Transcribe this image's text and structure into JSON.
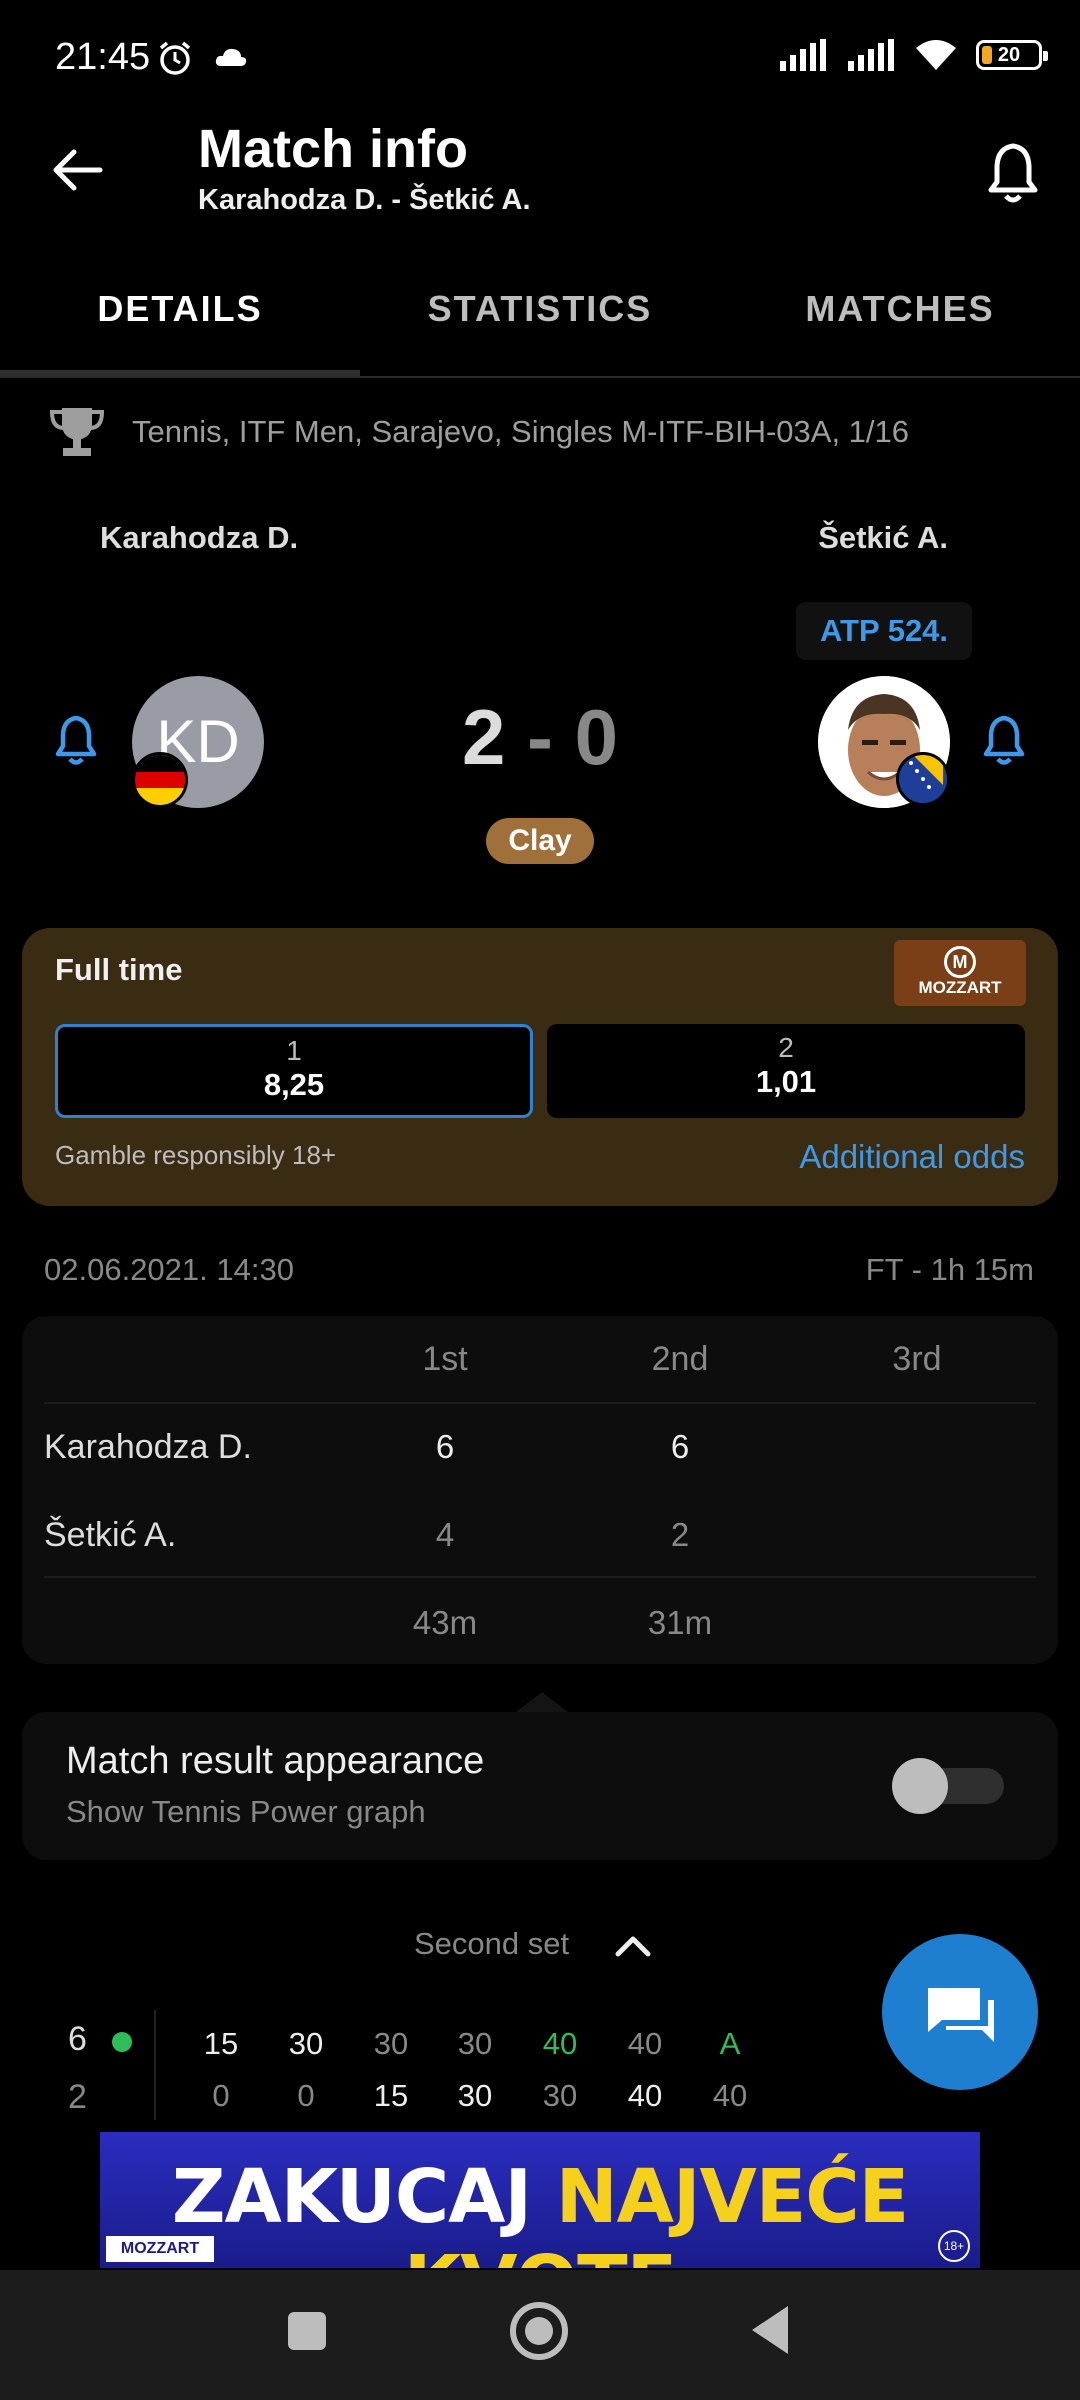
{
  "status_bar": {
    "time": "21:45",
    "battery": "20"
  },
  "header": {
    "title": "Match info",
    "subtitle": "Karahodza D. - Šetkić A."
  },
  "tabs": [
    {
      "label": "DETAILS",
      "active": true
    },
    {
      "label": "STATISTICS",
      "active": false
    },
    {
      "label": "MATCHES",
      "active": false
    }
  ],
  "tournament": "Tennis, ITF Men, Sarajevo, Singles M-ITF-BIH-03A, 1/16",
  "player1": {
    "name": "Karahodza D.",
    "initials": "KD"
  },
  "player2": {
    "name": "Šetkić A.",
    "ranking": "ATP 524."
  },
  "score": {
    "home": "2",
    "separator": "-",
    "away": "0"
  },
  "surface": "Clay",
  "odds": {
    "title": "Full time",
    "bookmaker": "MOZZART",
    "options": [
      {
        "label": "1",
        "value": "8,25",
        "selected": true
      },
      {
        "label": "2",
        "value": "1,01",
        "selected": false
      }
    ],
    "disclaimer": "Gamble responsibly 18+",
    "additional": "Additional odds"
  },
  "match_time": {
    "datetime": "02.06.2021. 14:30",
    "status": "FT - 1h 15m"
  },
  "sets_table": {
    "headers": [
      "1st",
      "2nd",
      "3rd"
    ],
    "rows": [
      {
        "name": "Karahodza D.",
        "scores": [
          "6",
          "6",
          ""
        ]
      },
      {
        "name": "Šetkić A.",
        "scores": [
          "4",
          "2",
          ""
        ]
      }
    ],
    "durations": [
      "43m",
      "31m",
      ""
    ]
  },
  "result_appearance": {
    "title": "Match result appearance",
    "subtitle": "Show Tennis Power graph",
    "enabled": false
  },
  "set_selector": "Second set",
  "point_by_point": {
    "game_score_top": "6",
    "game_score_bottom": "2",
    "top": [
      "15",
      "30",
      "30",
      "30",
      "40",
      "40",
      "A"
    ],
    "bottom": [
      "0",
      "0",
      "15",
      "30",
      "30",
      "40",
      "40"
    ]
  },
  "ad": {
    "text_white": "ZAKUCAJ",
    "text_yellow": "NAJVEĆE KVOTE",
    "brand": "MOZZART",
    "age": "18+"
  },
  "colors": {
    "accent": "#3e9ae9",
    "clay": "#a0703a",
    "green": "#2ebd59",
    "fab": "#1e7fd1"
  }
}
